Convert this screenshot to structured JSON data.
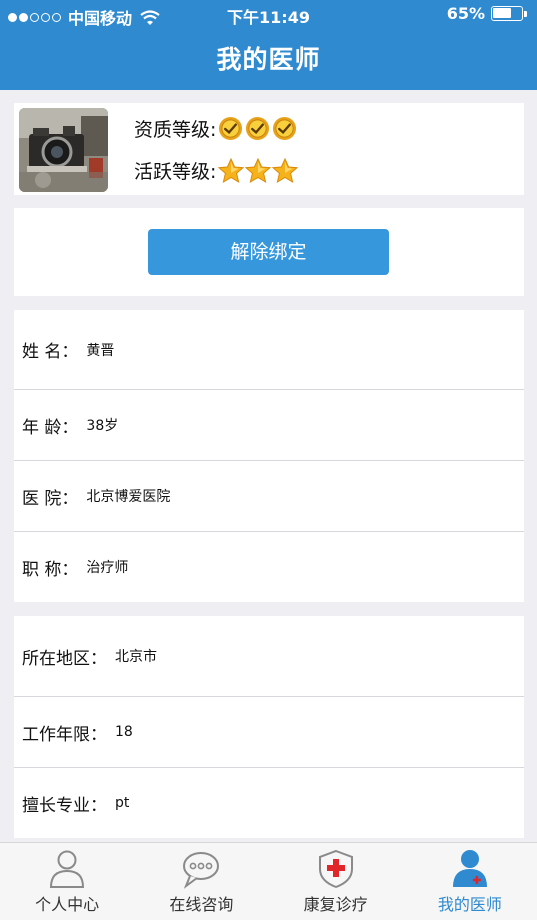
{
  "status_bar": {
    "carrier": "中国移动",
    "time": "下午11:49",
    "battery": "65%",
    "battery_level": 0.65
  },
  "nav": {
    "title": "我的医师"
  },
  "profile": {
    "avatar_icon": "camera-photo",
    "qualification_label": "资质等级:",
    "qualification_level": 3,
    "activity_label": "活跃等级:",
    "activity_level": 3
  },
  "actions": {
    "unbind_label": "解除绑定"
  },
  "doctor_info": [
    {
      "label": "姓 名：",
      "value": "黄晋"
    },
    {
      "label": "年 龄：",
      "value": "38岁"
    },
    {
      "label": "医 院：",
      "value": "北京博爱医院"
    },
    {
      "label": "职 称：",
      "value": "治疗师"
    }
  ],
  "work_info": [
    {
      "label": "所在地区：",
      "value": "北京市"
    },
    {
      "label": "工作年限：",
      "value": "18"
    },
    {
      "label": "擅长专业：",
      "value": "pt"
    }
  ],
  "tabbar": {
    "active_color": "#2f8ad0",
    "tabs": [
      {
        "label": "个人中心",
        "icon": "person-icon"
      },
      {
        "label": "在线咨询",
        "icon": "chat-icon"
      },
      {
        "label": "康复诊疗",
        "icon": "shield-cross-icon"
      },
      {
        "label": "我的医师",
        "icon": "doctor-icon"
      }
    ]
  },
  "colors": {
    "header": "#2f8ad0",
    "button": "#3797dc",
    "background": "#eeeef3"
  }
}
